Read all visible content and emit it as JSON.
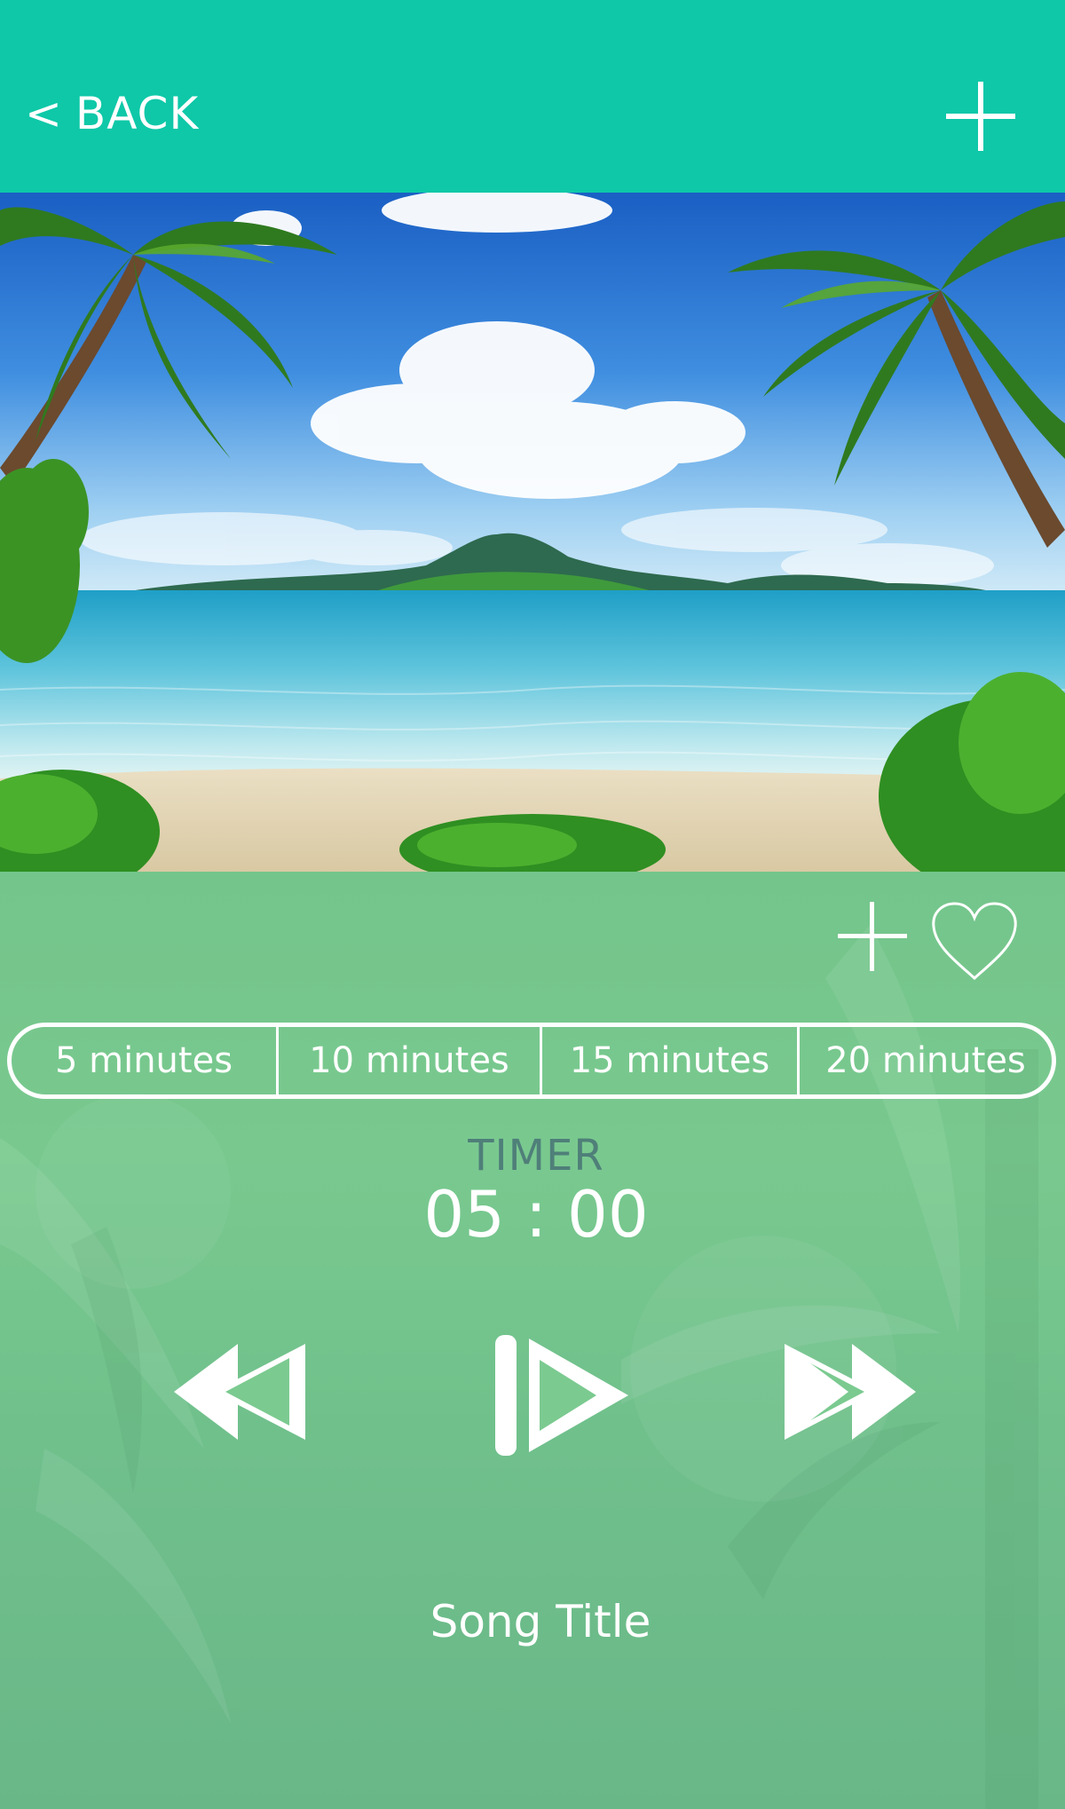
{
  "header": {
    "back_label": "BACK",
    "add_icon": "plus-icon",
    "background": "#0ec8a8"
  },
  "hero": {
    "icon": "beach-scene-image"
  },
  "actions": {
    "add_icon": "plus-icon",
    "favorite_icon": "heart-outline-icon"
  },
  "durations": [
    "5 minutes",
    "10 minutes",
    "15 minutes",
    "20 minutes"
  ],
  "timer": {
    "label": "TIMER",
    "value": "05 : 00"
  },
  "controls": {
    "rewind_icon": "rewind-icon",
    "play_icon": "play-icon",
    "forward_icon": "fast-forward-icon"
  },
  "song": {
    "title": "Song Title"
  },
  "colors": {
    "accent": "#0ec8a8",
    "panel": "#74c58b",
    "timer_label": "#4f7f79",
    "text": "#ffffff"
  }
}
